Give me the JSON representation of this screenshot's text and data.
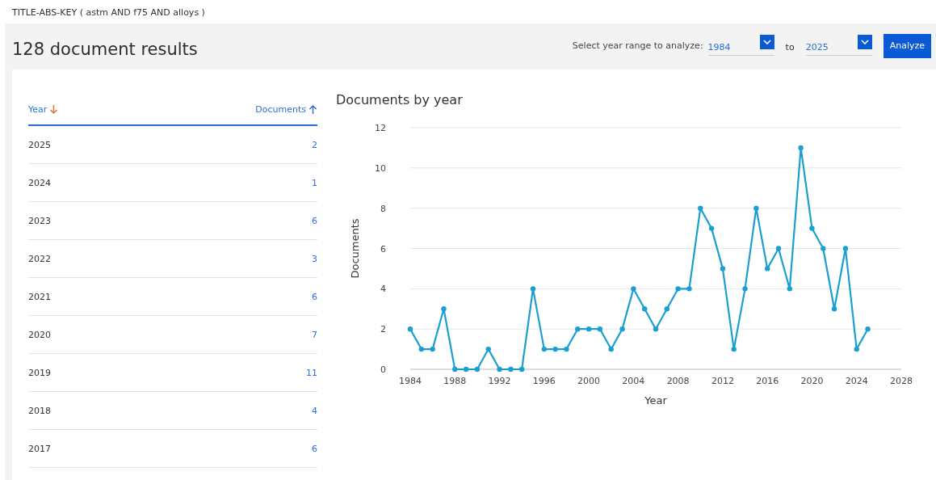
{
  "query": "TITLE-ABS-KEY ( astm  AND f75  AND alloys )",
  "results_title": "128 document results",
  "year_range": {
    "label": "Select year range to analyze:",
    "from": "1984",
    "separator": "to",
    "to": "2025",
    "button": "Analyze"
  },
  "table": {
    "columns": [
      {
        "label": "Year",
        "selected": true
      },
      {
        "label": "Documents",
        "selected": false
      }
    ],
    "rows": [
      {
        "year": "2025",
        "documents": "2"
      },
      {
        "year": "2024",
        "documents": "1"
      },
      {
        "year": "2023",
        "documents": "6"
      },
      {
        "year": "2022",
        "documents": "3"
      },
      {
        "year": "2021",
        "documents": "6"
      },
      {
        "year": "2020",
        "documents": "7"
      },
      {
        "year": "2019",
        "documents": "11"
      },
      {
        "year": "2018",
        "documents": "4"
      },
      {
        "year": "2017",
        "documents": "6"
      }
    ]
  },
  "chart": {
    "chart_data": {
      "type": "line",
      "title": "Documents by year",
      "xlabel": "Year",
      "ylabel": "Documents",
      "x": [
        1984,
        1985,
        1986,
        1987,
        1988,
        1989,
        1990,
        1991,
        1992,
        1993,
        1994,
        1995,
        1996,
        1997,
        1998,
        1999,
        2000,
        2001,
        2002,
        2003,
        2004,
        2005,
        2006,
        2007,
        2008,
        2009,
        2010,
        2011,
        2012,
        2013,
        2014,
        2015,
        2016,
        2017,
        2018,
        2019,
        2020,
        2021,
        2022,
        2023,
        2024,
        2025
      ],
      "grid": true,
      "series": [
        {
          "color": "#1a9fd0",
          "marker": "circle",
          "values": [
            2,
            1,
            1,
            3,
            0,
            0,
            0,
            1,
            0,
            0,
            0,
            4,
            1,
            1,
            1,
            2,
            2,
            2,
            1,
            2,
            4,
            3,
            2,
            3,
            4,
            4,
            8,
            7,
            5,
            1,
            4,
            8,
            5,
            6,
            4,
            11,
            7,
            6,
            3,
            6,
            1,
            2
          ]
        }
      ],
      "xlim": [
        1984,
        2028
      ],
      "ylim": [
        0,
        12
      ],
      "xticks": [
        1984,
        1988,
        1992,
        1996,
        2000,
        2004,
        2008,
        2012,
        2016,
        2020,
        2024,
        2028
      ],
      "yticks": [
        0,
        2,
        4,
        6,
        8,
        10,
        12
      ]
    }
  }
}
